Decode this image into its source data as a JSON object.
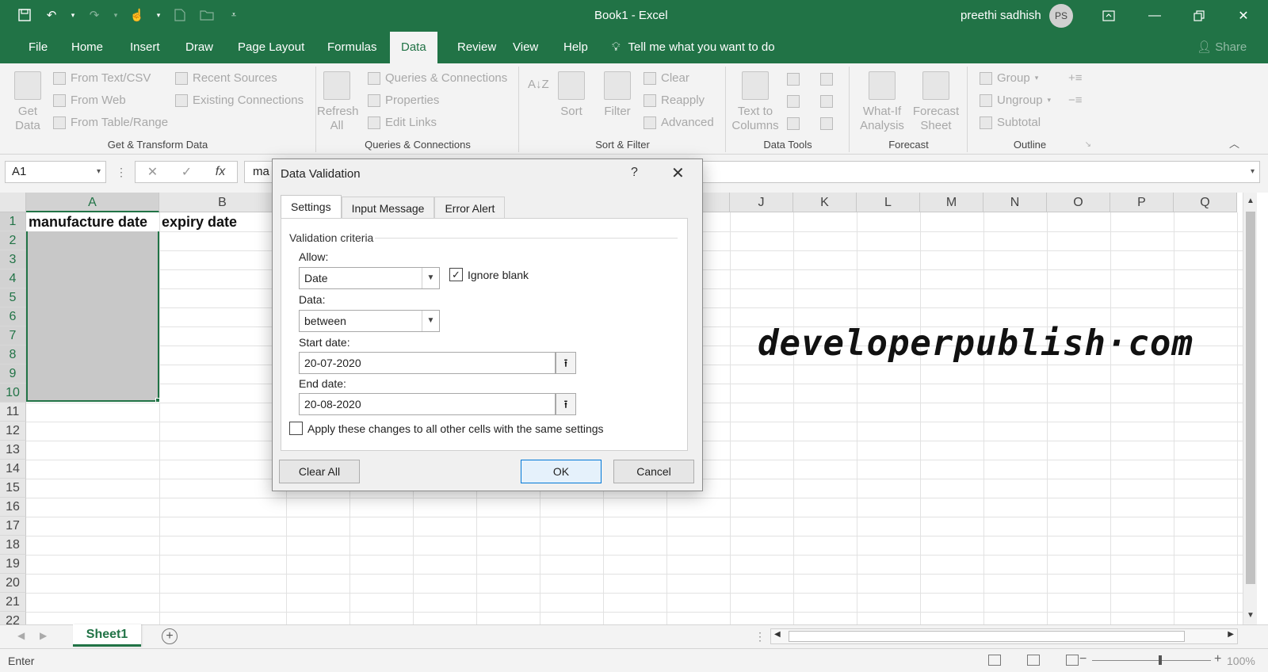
{
  "app": {
    "window_title": "Book1  -  Excel",
    "user_name": "preethi sadhish",
    "user_initials": "PS",
    "accent_color": "#217346"
  },
  "qat_icons": [
    "save-icon",
    "undo-icon",
    "redo-icon",
    "touch-mode-icon",
    "new-file-icon",
    "open-file-icon",
    "customize-qat-icon"
  ],
  "menu_tabs": [
    "File",
    "Home",
    "Insert",
    "Draw",
    "Page Layout",
    "Formulas",
    "Data",
    "Review",
    "View",
    "Help"
  ],
  "active_tab": "Data",
  "tell_me": "Tell me what you want to do",
  "share": "Share",
  "ribbon": {
    "get_transform": {
      "get_data": "Get Data",
      "from_text_csv": "From Text/CSV",
      "from_web": "From Web",
      "from_table_range": "From Table/Range",
      "recent_sources": "Recent Sources",
      "existing_connections": "Existing Connections",
      "label": "Get & Transform Data"
    },
    "queries": {
      "refresh_all": "Refresh All",
      "queries_connections": "Queries & Connections",
      "properties": "Properties",
      "edit_links": "Edit Links",
      "label": "Queries & Connections"
    },
    "sort_filter": {
      "sort": "Sort",
      "filter": "Filter",
      "clear": "Clear",
      "reapply": "Reapply",
      "advanced": "Advanced",
      "label": "Sort & Filter"
    },
    "data_tools": {
      "text_to_columns": "Text to Columns",
      "label": "Data Tools"
    },
    "forecast": {
      "what_if": "What-If Analysis",
      "forecast_sheet": "Forecast Sheet",
      "label": "Forecast"
    },
    "outline": {
      "group": "Group",
      "ungroup": "Ungroup",
      "subtotal": "Subtotal",
      "label": "Outline"
    }
  },
  "formula_bar": {
    "name_box": "A1",
    "formula": "ma",
    "fx": "fx"
  },
  "grid": {
    "columns": [
      "A",
      "B",
      "",
      "",
      "",
      "",
      "",
      "",
      "",
      "J",
      "K",
      "L",
      "M",
      "N",
      "O",
      "P",
      "Q"
    ],
    "rows": [
      "1",
      "2",
      "3",
      "4",
      "5",
      "6",
      "7",
      "8",
      "9",
      "10",
      "11",
      "12",
      "13",
      "14",
      "15",
      "16",
      "17",
      "18",
      "19",
      "20",
      "21",
      "22"
    ],
    "a1": "manufacture date",
    "b1": "expiry date",
    "watermark": "developerpublish·com"
  },
  "sheets": [
    "Sheet1"
  ],
  "status": {
    "mode": "Enter",
    "zoom": "100%"
  },
  "dialog": {
    "title": "Data Validation",
    "help": "?",
    "tabs": [
      "Settings",
      "Input Message",
      "Error Alert"
    ],
    "active_tab": "Settings",
    "section": "Validation criteria",
    "allow_label": "Allow:",
    "allow_value": "Date",
    "ignore_blank_label": "Ignore blank",
    "ignore_blank_checked": true,
    "data_label": "Data:",
    "data_value": "between",
    "start_label": "Start date:",
    "start_value": "20-07-2020",
    "end_label": "End date:",
    "end_value": "20-08-2020",
    "apply_all_label": "Apply these changes to all other cells with the same settings",
    "apply_all_checked": false,
    "clear_all": "Clear All",
    "ok": "OK",
    "cancel": "Cancel"
  }
}
